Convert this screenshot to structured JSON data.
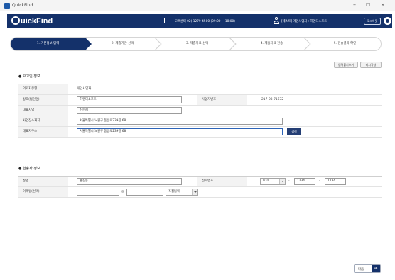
{
  "window": {
    "title": "QuickFind",
    "minimize": "–",
    "maximize": "☐",
    "close": "✕"
  },
  "header": {
    "logo_letter": "Q",
    "logo_text": "uickFind",
    "center_text": "고객센터 02) 1279-4500 (09:00 ~ 18:00)",
    "user_text": "[테스트] 개인사업자 : 히엔디소프트",
    "logout_label": "로그아웃",
    "icons": [
      "phone-icon",
      "user-icon",
      "gear-icon"
    ]
  },
  "steps": [
    {
      "label": "1. 기본정보 입력",
      "active": true
    },
    {
      "label": "2. 제출기관 선택",
      "active": false
    },
    {
      "label": "3. 제출자료 선택",
      "active": false
    },
    {
      "label": "4. 제출자료 전송",
      "active": false
    },
    {
      "label": "5. 전송결과 확인",
      "active": false
    }
  ],
  "top_buttons": {
    "fill_label": "입력불러오기",
    "save_label": "다시작성"
  },
  "section1": {
    "title": "● 요고인 정보",
    "rows": [
      {
        "label": "의뢰자유형",
        "value": "개인사업자"
      },
      {
        "label": "상호(법인명)",
        "value": "히엔디소프트",
        "label2": "사업자번호",
        "value2": "217-03-71672"
      },
      {
        "label": "대표자명",
        "value": "김한세"
      },
      {
        "label": "사업장소재지",
        "value": "서울특별시 노원구 동일로239길 68"
      },
      {
        "label": "대표자주소",
        "value": "서울특별시 노원구 동일로239길 68",
        "button": "검색"
      }
    ]
  },
  "section2": {
    "title": "● 한송자 정보",
    "rows": [
      {
        "label": "성명",
        "value": "홍길동",
        "label2": "전화번호",
        "phone": [
          "010",
          "1234",
          "1234"
        ]
      },
      {
        "label": "이메일(선택)",
        "value": "",
        "at": "@",
        "domain": "",
        "domain_select": "직접입력"
      }
    ]
  },
  "footer": {
    "next_label": "다음",
    "next_arrow": "➔"
  },
  "colors": {
    "navy": "#14316a",
    "primary": "#2d64b8"
  }
}
